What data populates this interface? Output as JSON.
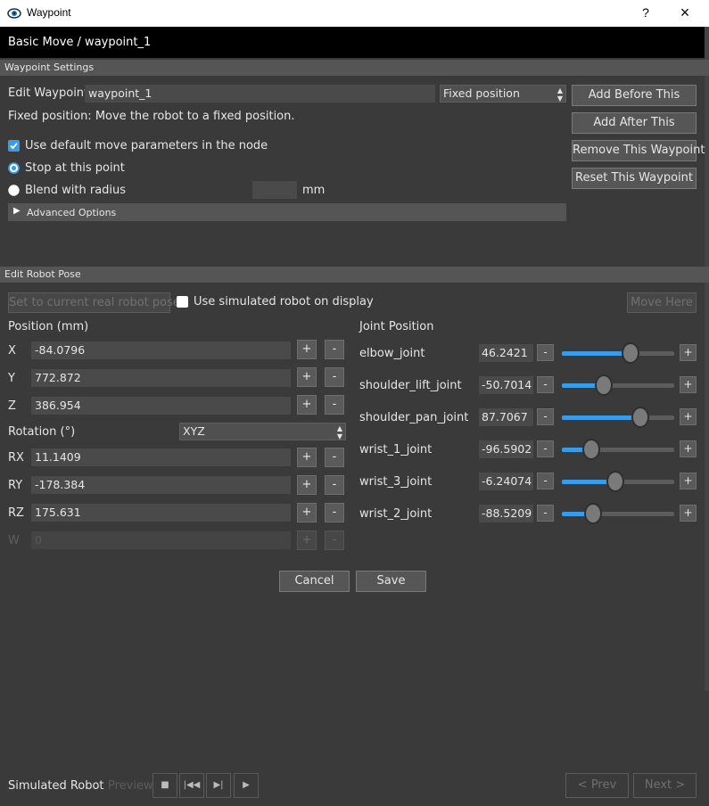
{
  "window": {
    "title": "Waypoint",
    "help_label": "?",
    "close_label": "×"
  },
  "breadcrumb": "Basic Move / waypoint_1",
  "waypoint_settings": {
    "header": "Waypoint Settings",
    "edit_label": "Edit Waypoint",
    "name_value": "waypoint_1",
    "type_selected": "Fixed position",
    "description": "Fixed position: Move the robot to a fixed position.",
    "use_default_label": "Use default move parameters in the node",
    "use_default_checked": true,
    "stop_label": "Stop at this point",
    "blend_label": "Blend with radius",
    "blend_value": "",
    "blend_unit": "mm",
    "advanced_label": "Advanced Options",
    "buttons": {
      "add_before": "Add Before This",
      "add_after": "Add After This",
      "remove": "Remove This Waypoint",
      "reset": "Reset This Waypoint"
    }
  },
  "robot_pose": {
    "header": "Edit Robot Pose",
    "set_current_label": "Set to current real robot pose",
    "use_simulated_label": "Use simulated robot on display",
    "move_here_label": "Move Here",
    "position_label": "Position (mm)",
    "rotation_label": "Rotation (°)",
    "rotation_mode": "XYZ",
    "coords": [
      {
        "label": "X",
        "value": "-84.0796",
        "disabled": false
      },
      {
        "label": "Y",
        "value": "772.872",
        "disabled": false
      },
      {
        "label": "Z",
        "value": "386.954",
        "disabled": false
      },
      {
        "label": "RX",
        "value": "11.1409",
        "disabled": false
      },
      {
        "label": "RY",
        "value": "-178.384",
        "disabled": false
      },
      {
        "label": "RZ",
        "value": "175.631",
        "disabled": false
      },
      {
        "label": "W",
        "value": "0",
        "disabled": true
      }
    ],
    "plus_label": "+",
    "minus_label": "-",
    "joint_label": "Joint Position",
    "joints": [
      {
        "name": "elbow_joint",
        "value": "46.2421",
        "fraction": 0.61
      },
      {
        "name": "shoulder_lift_joint",
        "value": "-50.7014",
        "fraction": 0.37
      },
      {
        "name": "shoulder_pan_joint",
        "value": "87.7067",
        "fraction": 0.7
      },
      {
        "name": "wrist_1_joint",
        "value": "-96.5902",
        "fraction": 0.26
      },
      {
        "name": "wrist_3_joint",
        "value": "-6.24074",
        "fraction": 0.48
      },
      {
        "name": "wrist_2_joint",
        "value": "-88.5209",
        "fraction": 0.28
      }
    ]
  },
  "dialog": {
    "cancel_label": "Cancel",
    "save_label": "Save"
  },
  "footer": {
    "simulated_label": "Simulated Robot",
    "preview_label": "Preview",
    "prev_label": "< Prev",
    "next_label": "Next >"
  },
  "colors": {
    "accent": "#3a9be8",
    "background": "#3a3a3a",
    "header": "#555555"
  }
}
